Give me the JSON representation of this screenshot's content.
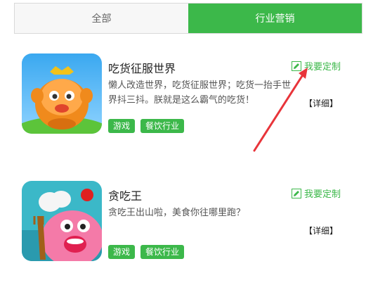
{
  "tabs": [
    {
      "label": "全部",
      "active": false
    },
    {
      "label": "行业营销",
      "active": true
    }
  ],
  "items": [
    {
      "title": "吃货征服世界",
      "description": "懒人改造世界，吃货征服世界；吃货一抬手世界抖三抖。朕就是这么霸气的吃货！",
      "custom_label": "我要定制",
      "detail_label": "【详细】",
      "tags": [
        "游戏",
        "餐饮行业"
      ],
      "thumb_icon": "monkey-game-icon"
    },
    {
      "title": "贪吃王",
      "description": "贪吃王出山啦，美食你往哪里跑？",
      "custom_label": "我要定制",
      "detail_label": "【详细】",
      "tags": [
        "游戏",
        "餐饮行业"
      ],
      "thumb_icon": "pig-chef-game-icon"
    }
  ],
  "colors": {
    "accent": "#3cb84a",
    "annotation_arrow": "#e8343a"
  }
}
